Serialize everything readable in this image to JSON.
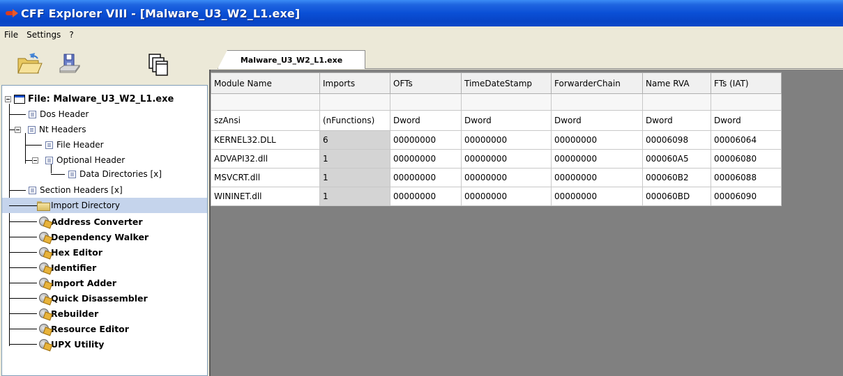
{
  "window": {
    "title": "CFF Explorer VIII - [Malware_U3_W2_L1.exe]"
  },
  "menu": {
    "items": [
      "File",
      "Settings",
      "?"
    ]
  },
  "toolbar": {
    "icons": [
      "open-folder-icon",
      "save-disk-icon",
      "windows-icon"
    ]
  },
  "tree": {
    "root": "File: Malware_U3_W2_L1.exe",
    "items": [
      {
        "label": "Dos Header"
      },
      {
        "label": "Nt Headers"
      },
      {
        "label": "File Header"
      },
      {
        "label": "Optional Header"
      },
      {
        "label": "Data Directories [x]"
      },
      {
        "label": "Section Headers [x]"
      },
      {
        "label": "Import Directory"
      }
    ],
    "tools": [
      "Address Converter",
      "Dependency Walker",
      "Hex Editor",
      "Identifier",
      "Import Adder",
      "Quick Disassembler",
      "Rebuilder",
      "Resource Editor",
      "UPX Utility"
    ]
  },
  "tab": {
    "label": "Malware_U3_W2_L1.exe"
  },
  "table": {
    "columns": [
      "Module Name",
      "Imports",
      "OFTs",
      "TimeDateStamp",
      "ForwarderChain",
      "Name RVA",
      "FTs (IAT)"
    ],
    "types": [
      "szAnsi",
      "(nFunctions)",
      "Dword",
      "Dword",
      "Dword",
      "Dword",
      "Dword"
    ],
    "rows": [
      [
        "KERNEL32.DLL",
        "6",
        "00000000",
        "00000000",
        "00000000",
        "00006098",
        "00006064"
      ],
      [
        "ADVAPI32.dll",
        "1",
        "00000000",
        "00000000",
        "00000000",
        "000060A5",
        "00006080"
      ],
      [
        "MSVCRT.dll",
        "1",
        "00000000",
        "00000000",
        "00000000",
        "000060B2",
        "00006088"
      ],
      [
        "WININET.dll",
        "1",
        "00000000",
        "00000000",
        "00000000",
        "000060BD",
        "00006090"
      ]
    ]
  }
}
